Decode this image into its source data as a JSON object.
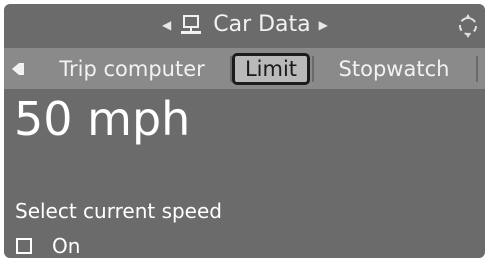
{
  "header": {
    "title": "Car Data",
    "icon": "car-data-icon",
    "nav_left_icon": "chevron-left-icon",
    "nav_right_icon": "chevron-right-icon",
    "settings_icon": "settings-dial-icon"
  },
  "tabs": {
    "back_icon": "back-icon",
    "items": [
      {
        "label": "Trip computer",
        "selected": false
      },
      {
        "label": "Limit",
        "selected": true
      },
      {
        "label": "Stopwatch",
        "selected": false
      }
    ]
  },
  "main": {
    "speed_value": "50 mph",
    "select_label": "Select current speed",
    "option_label": "On",
    "option_checked": false
  },
  "colors": {
    "background": "#6b6b6b",
    "tab_bar": "#8a8a8a",
    "selected_tab": "#b9b9b9",
    "text": "#ffffff"
  }
}
